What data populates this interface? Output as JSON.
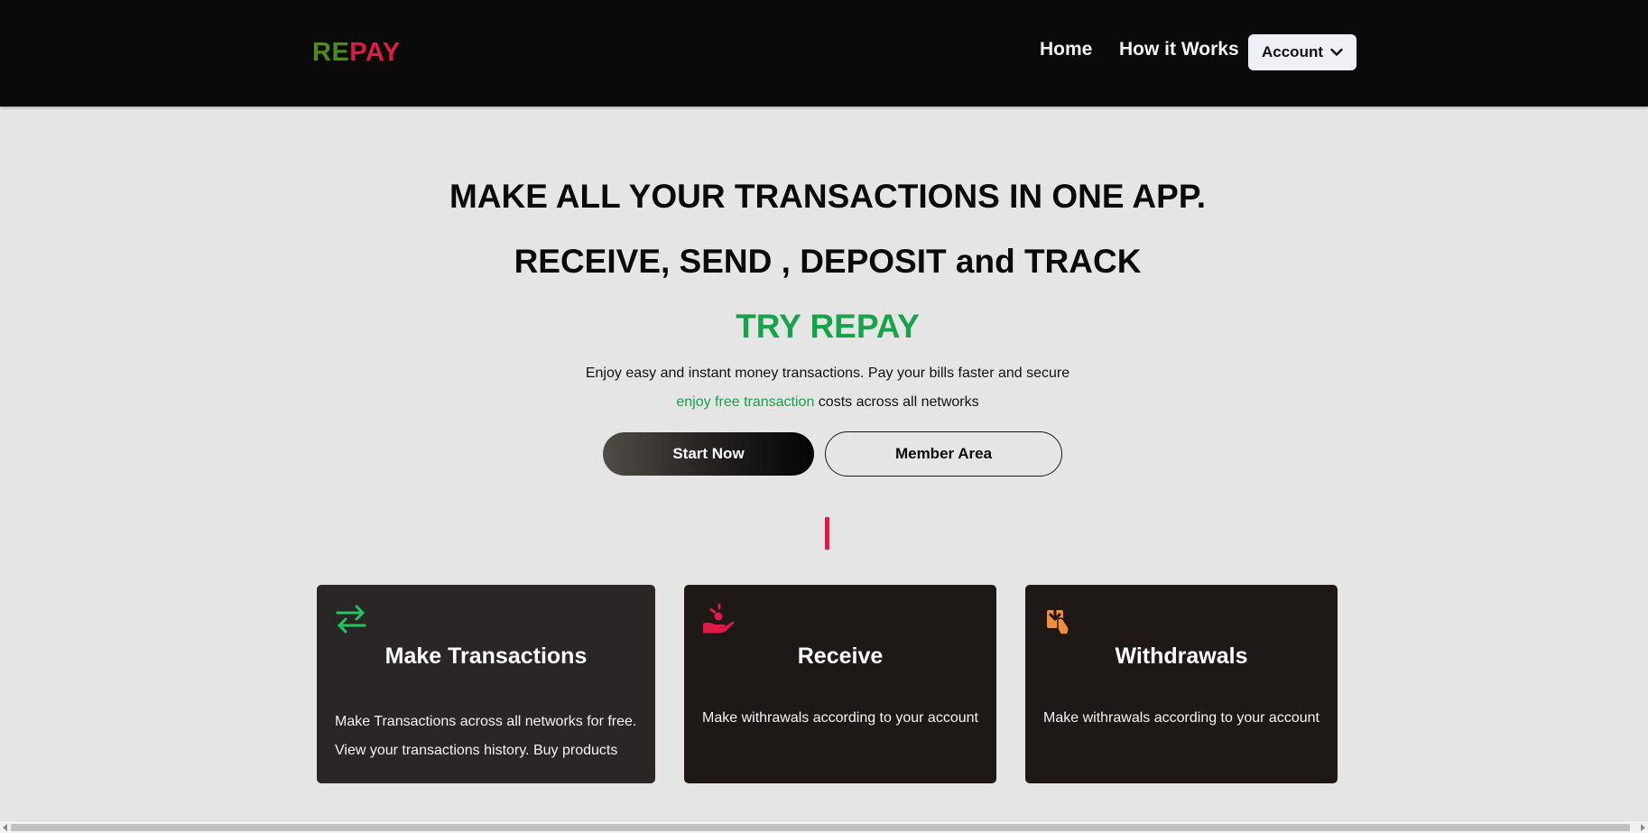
{
  "header": {
    "logo": {
      "part1": "RE",
      "part2": "PAY"
    },
    "nav": {
      "home": "Home",
      "how_it_works": "How it Works"
    },
    "account": {
      "label": "Account",
      "icon": "chevron-down-icon"
    }
  },
  "hero": {
    "headline": "MAKE ALL YOUR TRANSACTIONS IN ONE APP.",
    "subheadline": "RECEIVE, SEND , DEPOSIT and TRACK",
    "cta_heading": "TRY REPAY",
    "description_line1": "Enjoy easy and instant money transactions. Pay your bills faster and secure",
    "description_line2_highlight": "enjoy free transaction",
    "description_line2_rest": " costs across all networks",
    "start_button": "Start Now",
    "member_button": "Member Area"
  },
  "features": [
    {
      "icon": "transfer-arrows-icon",
      "title": "Make Transactions",
      "text_line1": "Make Transactions across all networks for free.",
      "text_line2": "View your transactions history. Buy products"
    },
    {
      "icon": "hand-receive-icon",
      "title": "Receive",
      "text_line1": "Make withrawals according to your account"
    },
    {
      "icon": "withdraw-icon",
      "title": "Withdrawals",
      "text_line1": "Make withrawals according to your account"
    }
  ],
  "colors": {
    "nav_bg": "#0a0a0a",
    "page_bg": "#e5e5e5",
    "logo_re": "#4d8a1f",
    "logo_pay": "#e01a45",
    "brand_green": "#16a34a",
    "accent_red": "#e01a45",
    "card_bg": "#1e1917",
    "icon_orange": "#f28c38",
    "icon_green": "#22c55e"
  }
}
